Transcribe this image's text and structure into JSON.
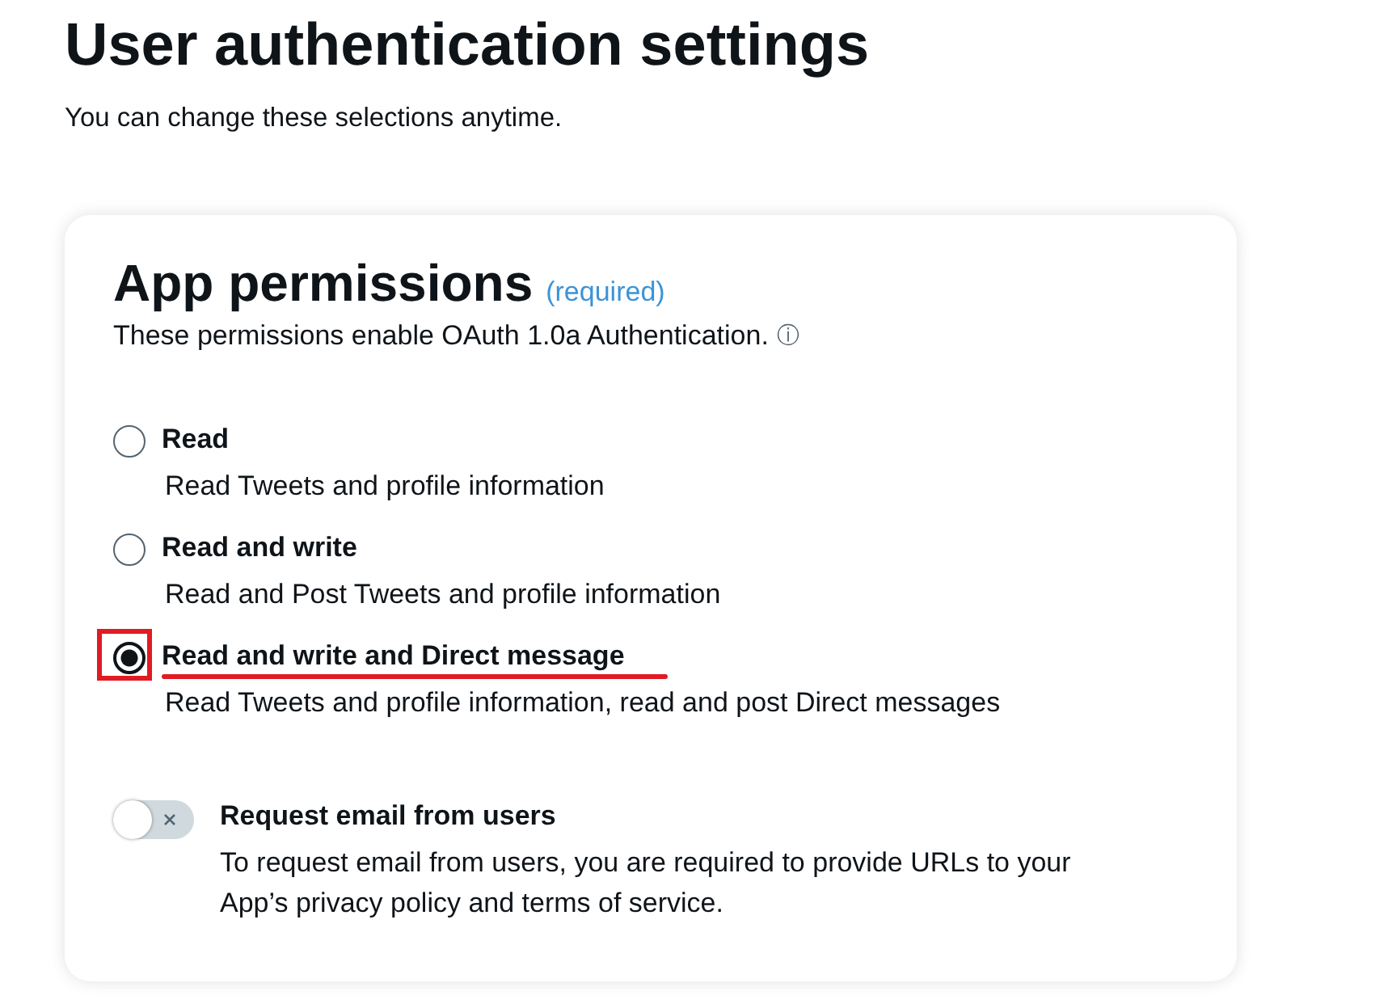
{
  "page": {
    "title": "User authentication settings",
    "subtitle": "You can change these selections anytime."
  },
  "permissions": {
    "title": "App permissions",
    "required_note": "(required)",
    "description": "These permissions enable OAuth 1.0a Authentication.",
    "info_icon": "ⓘ",
    "options": [
      {
        "label": "Read",
        "detail": "Read Tweets and profile information",
        "selected": false,
        "annotated": false
      },
      {
        "label": "Read and write",
        "detail": "Read and Post Tweets and profile information",
        "selected": false,
        "annotated": false
      },
      {
        "label": "Read and write and Direct message",
        "detail": "Read Tweets and profile information, read and post Direct messages",
        "selected": true,
        "annotated": true
      }
    ],
    "email_toggle": {
      "label": "Request email from users",
      "detail": "To request email from users, you are required to provide URLs to your App’s privacy policy and terms of service.",
      "on": false
    }
  }
}
